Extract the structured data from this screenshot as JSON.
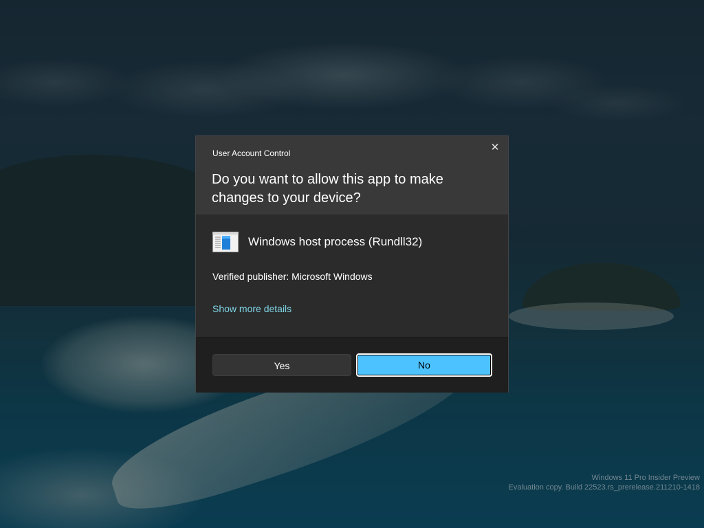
{
  "dialog": {
    "caption": "User Account Control",
    "close_glyph": "✕",
    "question": "Do you want to allow this app to make changes to your device?",
    "app_name": "Windows host process (Rundll32)",
    "app_icon": "window-app-icon",
    "publisher": "Verified publisher: Microsoft Windows",
    "more_details": "Show more details",
    "yes_label": "Yes",
    "no_label": "No",
    "accent_color": "#4cc2ff",
    "link_color": "#7fd6e6"
  },
  "watermark": {
    "line1": "Windows 11 Pro Insider Preview",
    "line2": "Evaluation copy. Build 22523.rs_prerelease.211210-1418"
  }
}
